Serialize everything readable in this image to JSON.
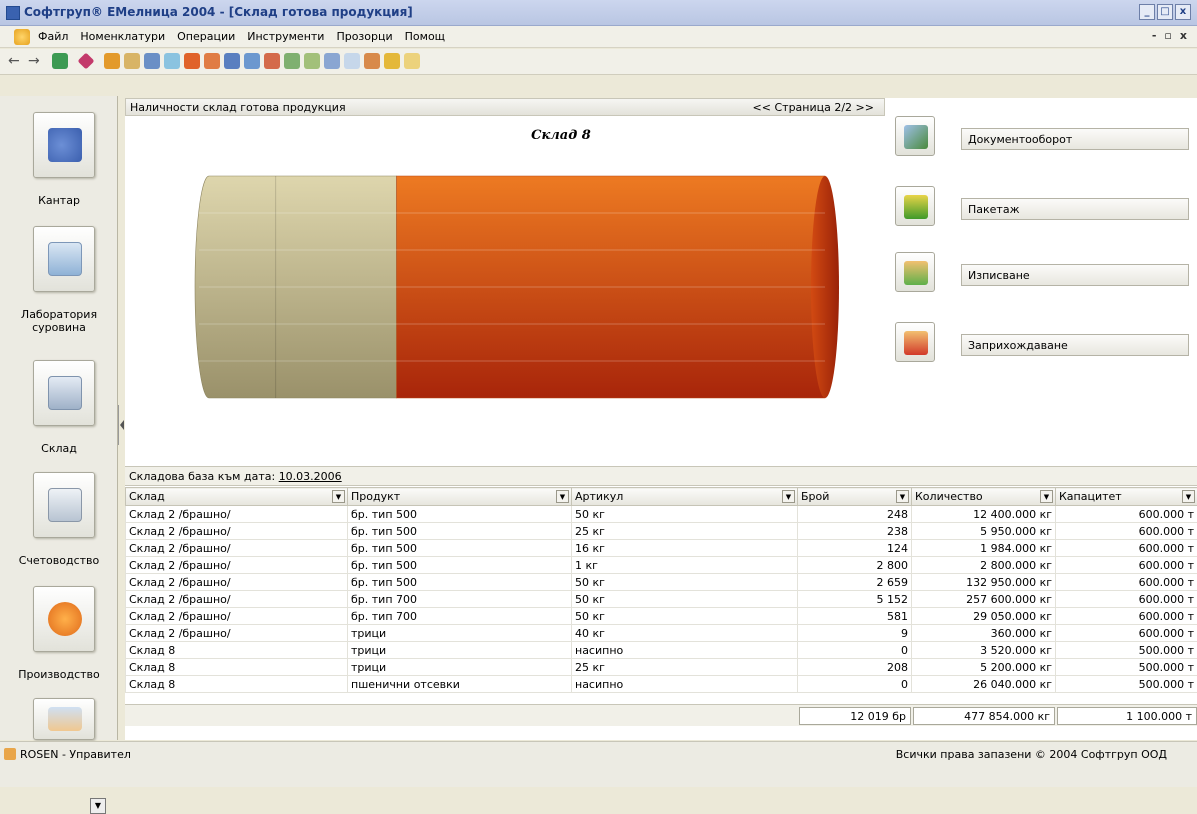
{
  "window": {
    "title": "Софтгруп® ЕМелница 2004 - [Склад готова продукция]",
    "controls": [
      "_",
      "□",
      "x"
    ]
  },
  "menu": {
    "items": [
      "Файл",
      "Номенклатури",
      "Операции",
      "Инструменти",
      "Прозорци",
      "Помощ"
    ],
    "mdi_controls": [
      "-",
      "▫",
      "x"
    ]
  },
  "toolbar": {
    "icons": [
      "back-arrow-icon",
      "forward-arrow-icon",
      "refresh-icon",
      "diamond-icon",
      "home-icon",
      "folder-tree-icon",
      "users-icon",
      "window-icon",
      "chart-icon",
      "grid-icon",
      "table-icon",
      "report-icon",
      "calendar-icon",
      "people-icon",
      "group-icon",
      "people-settings-icon",
      "calendar-check-icon",
      "gift-icon",
      "dollar-icon",
      "folder-icon"
    ]
  },
  "sidebar": {
    "items": [
      {
        "label": "Кантар",
        "icon": "scale-icon"
      },
      {
        "label": "Лаборатория суровина",
        "icon": "flask-icon"
      },
      {
        "label": "Склад",
        "icon": "database-icon"
      },
      {
        "label": "Счетоводство",
        "icon": "calculator-icon"
      },
      {
        "label": "Производство",
        "icon": "gear-icon"
      }
    ]
  },
  "panel": {
    "header": "Наличности склад готова продукция",
    "pager": "<<  Страница 2/2  >>",
    "chart_title": "Склад 8",
    "fill_fraction": 0.6,
    "colors": {
      "used": "#d2581a",
      "free": "#c8bf95"
    }
  },
  "actions": [
    {
      "label": "Документооборот",
      "icon": "documents-flow-icon"
    },
    {
      "label": "Пакетаж",
      "icon": "package-icon"
    },
    {
      "label": "Изписване",
      "icon": "dispatch-icon"
    },
    {
      "label": "Заприхождаване",
      "icon": "receive-icon"
    }
  ],
  "grid": {
    "caption": "Складова база към дата:",
    "date": "10.03.2006",
    "columns": [
      "Склад",
      "Продукт",
      "Артикул",
      "Брой",
      "Количество",
      "Капацитет"
    ],
    "rows": [
      [
        "Склад 2 /брашно/",
        "бр. тип 500",
        "50 кг",
        "248",
        "12 400.000 кг",
        "600.000 т"
      ],
      [
        "Склад 2 /брашно/",
        "бр. тип 500",
        "25 кг",
        "238",
        "5 950.000 кг",
        "600.000 т"
      ],
      [
        "Склад 2 /брашно/",
        "бр. тип 500",
        "16 кг",
        "124",
        "1 984.000 кг",
        "600.000 т"
      ],
      [
        "Склад 2 /брашно/",
        "бр. тип 500",
        "1 кг",
        "2 800",
        "2 800.000 кг",
        "600.000 т"
      ],
      [
        "Склад 2 /брашно/",
        "бр. тип 500",
        "50 кг",
        "2 659",
        "132 950.000 кг",
        "600.000 т"
      ],
      [
        "Склад 2 /брашно/",
        "бр. тип 700",
        "50 кг",
        "5 152",
        "257 600.000 кг",
        "600.000 т"
      ],
      [
        "Склад 2 /брашно/",
        "бр. тип 700",
        "50 кг",
        "581",
        "29 050.000 кг",
        "600.000 т"
      ],
      [
        "Склад 2 /брашно/",
        "трици",
        "40 кг",
        "9",
        "360.000 кг",
        "600.000 т"
      ],
      [
        "Склад 8",
        "трици",
        "насипно",
        "0",
        "3 520.000 кг",
        "500.000 т"
      ],
      [
        "Склад 8",
        "трици",
        "25 кг",
        "208",
        "5 200.000 кг",
        "500.000 т"
      ],
      [
        "Склад 8",
        "пшенични отсевки",
        "насипно",
        "0",
        "26 040.000 кг",
        "500.000 т"
      ]
    ],
    "totals": {
      "count": "12 019 бр",
      "quantity": "477 854.000 кг",
      "capacity": "1 100.000 т"
    }
  },
  "status": {
    "user": "ROSEN  -  Управител",
    "copyright": "Всички права запазени © 2004 Софтгруп ООД"
  }
}
